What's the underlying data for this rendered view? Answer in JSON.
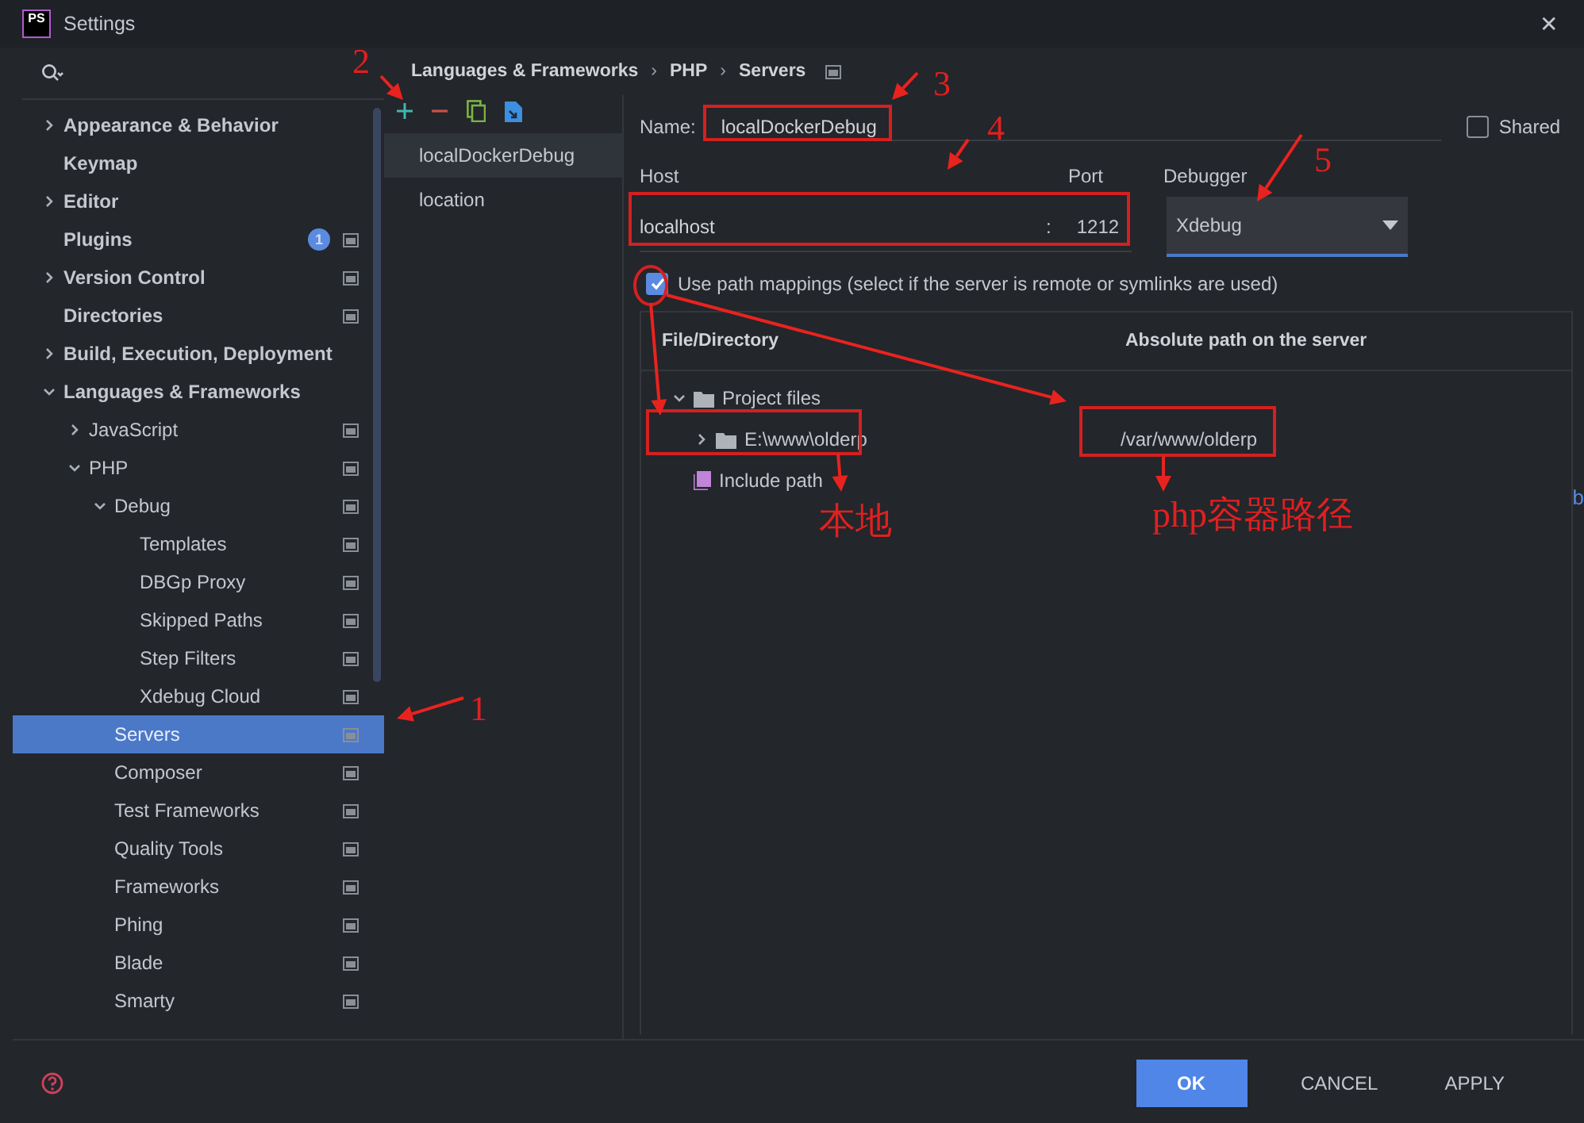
{
  "window": {
    "logo": "PS",
    "title": "Settings",
    "close": "✕"
  },
  "sidebar": {
    "items": [
      {
        "label": "Appearance & Behavior",
        "expanded": false,
        "selected": false
      },
      {
        "label": "Keymap",
        "selected": false
      },
      {
        "label": "Editor",
        "expanded": false,
        "selected": false
      },
      {
        "label": "Plugins",
        "badge": "1",
        "project_level": true,
        "selected": false
      },
      {
        "label": "Version Control",
        "expanded": false,
        "project_level": true,
        "selected": false
      },
      {
        "label": "Directories",
        "project_level": true,
        "selected": false
      },
      {
        "label": "Build, Execution, Deployment",
        "expanded": false,
        "selected": false
      },
      {
        "label": "Languages & Frameworks",
        "expanded": true,
        "selected": false,
        "children": [
          {
            "label": "JavaScript",
            "expanded": false,
            "project_level": true,
            "selected": false
          },
          {
            "label": "PHP",
            "expanded": true,
            "project_level": true,
            "selected": false,
            "children": [
              {
                "label": "Debug",
                "expanded": true,
                "project_level": true,
                "selected": false,
                "children": [
                  {
                    "label": "Templates",
                    "project_level": true,
                    "selected": false
                  },
                  {
                    "label": "DBGp Proxy",
                    "project_level": true,
                    "selected": false
                  },
                  {
                    "label": "Skipped Paths",
                    "project_level": true,
                    "selected": false
                  },
                  {
                    "label": "Step Filters",
                    "project_level": true,
                    "selected": false
                  },
                  {
                    "label": "Xdebug Cloud",
                    "project_level": true,
                    "selected": false
                  }
                ]
              },
              {
                "label": "Servers",
                "project_level": true,
                "selected": true
              },
              {
                "label": "Composer",
                "project_level": true,
                "selected": false
              },
              {
                "label": "Test Frameworks",
                "project_level": true,
                "selected": false
              },
              {
                "label": "Quality Tools",
                "project_level": true,
                "selected": false
              },
              {
                "label": "Frameworks",
                "project_level": true,
                "selected": false
              },
              {
                "label": "Phing",
                "project_level": true,
                "selected": false
              },
              {
                "label": "Blade",
                "project_level": true,
                "selected": false
              },
              {
                "label": "Smarty",
                "project_level": true,
                "selected": false
              }
            ]
          }
        ]
      }
    ]
  },
  "breadcrumb": [
    {
      "label": "Languages & Frameworks"
    },
    {
      "separator": "›",
      "label": "PHP"
    },
    {
      "separator": "›",
      "label": "Servers"
    }
  ],
  "servers": [
    {
      "label": "localDockerDebug",
      "selected": true
    },
    {
      "label": "location",
      "selected": false
    }
  ],
  "form": {
    "name_label": "Name:",
    "name": "localDockerDebug",
    "shared_label": "Shared",
    "shared": false,
    "host_label": "Host",
    "host": "localhost",
    "port_separator": ":",
    "port_label": "Port",
    "port": "1212",
    "debugger_label": "Debugger",
    "debugger": "Xdebug",
    "use_mappings": true,
    "use_mappings_label": "Use path mappings (select if the server is remote or symlinks are used)"
  },
  "mappings": {
    "columns": [
      "File/Directory",
      "Absolute path on the server"
    ],
    "rows": [
      {
        "kind": "project",
        "local": "Project files",
        "expanded": true,
        "children": [
          {
            "kind": "folder",
            "local": "E:\\www\\olderp",
            "remote": "/var/www/olderp",
            "expanded": false
          }
        ]
      },
      {
        "kind": "include",
        "local": "Include path"
      }
    ]
  },
  "background_text": "b",
  "buttons": [
    {
      "label": "OK",
      "kind": "primary"
    },
    {
      "label": "CANCEL",
      "kind": "plain"
    },
    {
      "label": "APPLY",
      "kind": "plain"
    }
  ],
  "annotations": [
    {
      "kind": "number",
      "text": "1"
    },
    {
      "kind": "number",
      "text": "2"
    },
    {
      "kind": "number",
      "text": "3"
    },
    {
      "kind": "number",
      "text": "4"
    },
    {
      "kind": "number",
      "text": "5"
    },
    {
      "kind": "label",
      "text": "本地"
    },
    {
      "kind": "label",
      "text": "php容器路径"
    }
  ]
}
